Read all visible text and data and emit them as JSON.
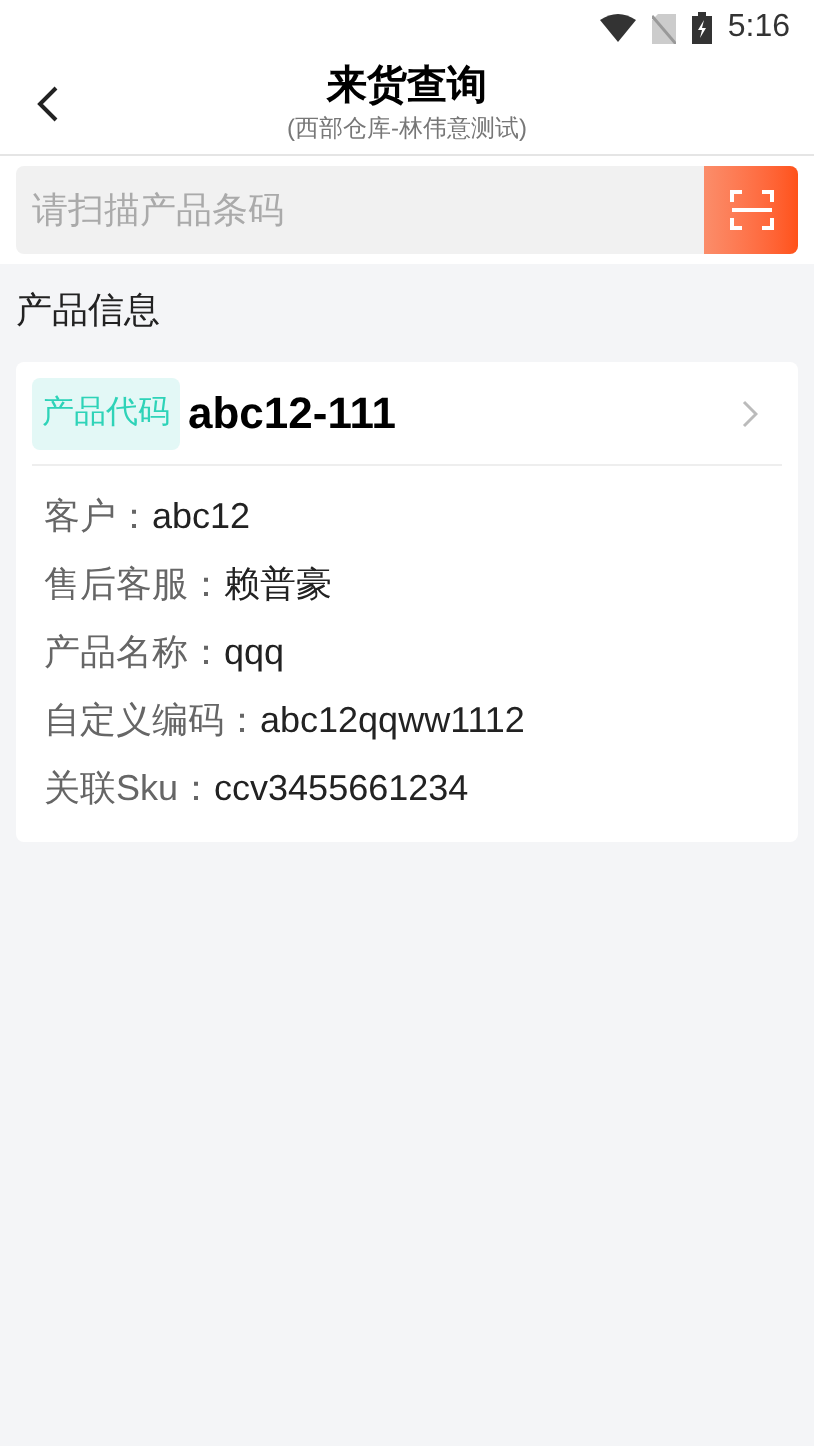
{
  "status_bar": {
    "time": "5:16"
  },
  "header": {
    "title": "来货查询",
    "subtitle": "(西部仓库-林伟意测试)"
  },
  "search": {
    "placeholder": "请扫描产品条码"
  },
  "section_title": "产品信息",
  "product": {
    "code_label": "产品代码",
    "code": "abc12-111",
    "fields": [
      {
        "label": "客户：",
        "value": "abc12"
      },
      {
        "label": "售后客服：",
        "value": "赖普豪"
      },
      {
        "label": "产品名称：",
        "value": "qqq"
      },
      {
        "label": "自定义编码：",
        "value": "abc12qqww1112"
      },
      {
        "label": "关联Sku：",
        "value": "ccv3455661234"
      }
    ]
  }
}
